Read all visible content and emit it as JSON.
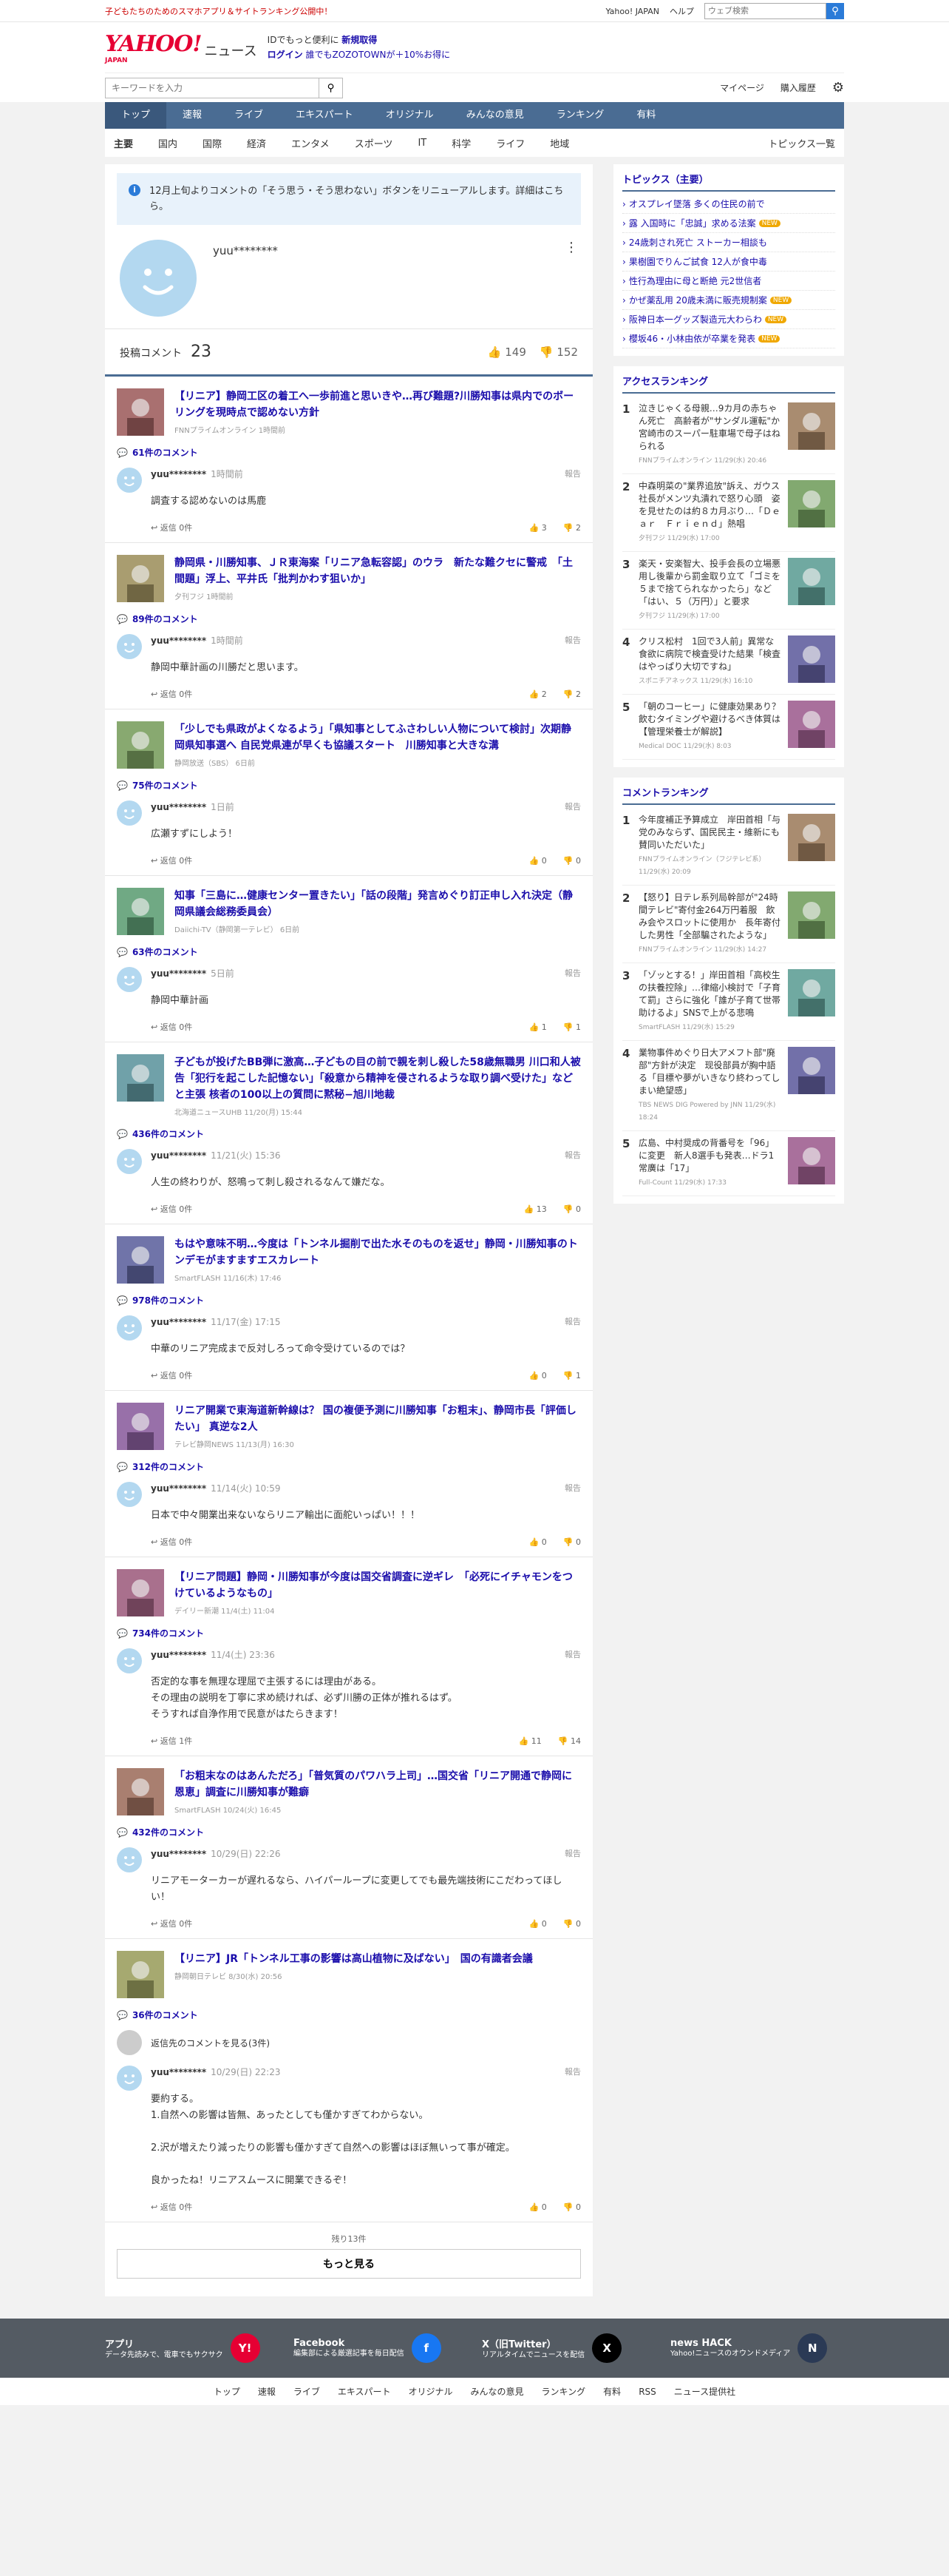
{
  "topbar": {
    "promo": "子どもたちのためのスマホアプリ＆サイトランキング公開中！",
    "link1": "Yahoo! JAPAN",
    "link2": "ヘルプ",
    "search_placeholder": "ウェブ検索"
  },
  "header": {
    "logo": "YAHOO!",
    "logo_sub": "JAPAN",
    "section": "ニュース",
    "line1a": "IDでもっと便利に",
    "line1b": "新規取得",
    "line2a": "ログイン",
    "line2b": "誰でもZOZOTOWNが＋10%お得に"
  },
  "searchrow": {
    "placeholder": "キーワードを入力",
    "mypage": "マイページ",
    "history": "購入履歴"
  },
  "gnav": [
    "トップ",
    "速報",
    "ライブ",
    "エキスパート",
    "オリジナル",
    "みんなの意見",
    "ランキング",
    "有料"
  ],
  "snav": [
    "主要",
    "国内",
    "国際",
    "経済",
    "エンタメ",
    "スポーツ",
    "IT",
    "科学",
    "ライフ",
    "地域"
  ],
  "snav_right": "トピックス一覧",
  "notice": "12月上旬よりコメントの「そう思う・そう思わない」ボタンをリニューアルします。詳細はこちら。",
  "profile": {
    "name": "yuu********",
    "count_label": "投稿コメント",
    "count": "23",
    "likes": "149",
    "dislikes": "152"
  },
  "reply_label": "返信",
  "report_label": "報告",
  "cards": [
    {
      "title": "【リニア】静岡工区の着工へ一歩前進と思いきや…再び難題?川勝知事は県内でのボーリングを現時点で認めない方針",
      "src": "FNNプライムオンライン 1時間前",
      "ccount": "61件のコメント",
      "user": "yuu********",
      "time": "1時間前",
      "text": "調査する認めないのは馬鹿",
      "replies": "0件",
      "up": "3",
      "down": "2"
    },
    {
      "title": "静岡県・川勝知事、ＪＲ東海案「リニア急転容認」のウラ　新たな難クセに警戒　「土間題」浮上、平井氏「批判かわす狙いか」",
      "src": "夕刊フジ 1時間前",
      "ccount": "89件のコメント",
      "user": "yuu********",
      "time": "1時間前",
      "text": "静岡中華計画の川勝だと思います。",
      "replies": "0件",
      "up": "2",
      "down": "2"
    },
    {
      "title": "「少しでも県政がよくなるよう」「県知事としてふさわしい人物について検討」次期静岡県知事選へ 自民党県連が早くも協議スタート　川勝知事と大きな溝",
      "src": "静岡放送（SBS） 6日前",
      "ccount": "75件のコメント",
      "user": "yuu********",
      "time": "1日前",
      "text": "広瀬すずにしよう！",
      "replies": "0件",
      "up": "0",
      "down": "0"
    },
    {
      "title": "知事「三島に…健康センター置きたい」「話の段階」発言めぐり訂正申し入れ決定（静岡県議会総務委員会）",
      "src": "Daiichi-TV（静岡第一テレビ） 6日前",
      "ccount": "63件のコメント",
      "user": "yuu********",
      "time": "5日前",
      "text": "静岡中華計画",
      "replies": "0件",
      "up": "1",
      "down": "1"
    },
    {
      "title": "子どもが投げたBB弾に激高…子どもの目の前で親を刺し殺した58歳無職男 川口和人被告「犯行を起こした記憶ない」「殺意から精神を侵されるような取り調べ受けた」などと主張 核者の100以上の質問に黙秘−旭川地裁",
      "src": "北海道ニュースUHB 11/20(月) 15:44",
      "ccount": "436件のコメント",
      "user": "yuu********",
      "time": "11/21(火) 15:36",
      "text": "人生の終わりが、怒鳴って刺し殺されるなんて嫌だな。",
      "replies": "0件",
      "up": "13",
      "down": "0"
    },
    {
      "title": "もはや意味不明…今度は「トンネル掘削で出た水そのものを返せ」静岡・川勝知事のトンデモがますますエスカレート",
      "src": "SmartFLASH 11/16(木) 17:46",
      "ccount": "978件のコメント",
      "user": "yuu********",
      "time": "11/17(金) 17:15",
      "text": "中華のリニア完成まで反対しろって命令受けているのでは？",
      "replies": "0件",
      "up": "0",
      "down": "1"
    },
    {
      "title": "リニア開業で東海道新幹線は？ 国の複便予測に川勝知事「お粗末」、静岡市長「評価したい」 真逆な2人",
      "src": "テレビ静岡NEWS 11/13(月) 16:30",
      "ccount": "312件のコメント",
      "user": "yuu********",
      "time": "11/14(火) 10:59",
      "text": "日本で中々開業出来ないならリニア輸出に面舵いっぱい！！！",
      "replies": "0件",
      "up": "0",
      "down": "0"
    },
    {
      "title": "【リニア問題】静岡・川勝知事が今度は国交省調査に逆ギレ　「必死にイチャモンをつけているようなもの」",
      "src": "デイリー新潮 11/4(土) 11:04",
      "ccount": "734件のコメント",
      "user": "yuu********",
      "time": "11/4(土) 23:36",
      "text": "否定的な事を無理な理屈で主張するには理由がある。\nその理由の説明を丁寧に求め続ければ、必ず川勝の正体が推れるはず。\nそうすれば自浄作用で民意がはたらきます！",
      "replies": "1件",
      "up": "11",
      "down": "14"
    },
    {
      "title": "「お粗末なのはあんただろ」「普気質のパワハラ上司」…国交省「リニア開通で静岡に恩恵」調査に川勝知事が難癖",
      "src": "SmartFLASH 10/24(火) 16:45",
      "ccount": "432件のコメント",
      "user": "yuu********",
      "time": "10/29(日) 22:26",
      "text": "リニアモーターカーが遅れるなら、ハイパーループに変更してでも最先端技術にこだわってほしい！",
      "replies": "0件",
      "up": "0",
      "down": "0"
    },
    {
      "title": "【リニア】JR「トンネル工事の影響は高山植物に及ばない」　国の有識者会議",
      "src": "静岡朝日テレビ 8/30(水) 20:56",
      "ccount": "36件のコメント",
      "prev": "返信先のコメントを見る(3件)",
      "user": "yuu********",
      "time": "10/29(日) 22:23",
      "text": "要約する。\n1.自然への影響は皆無、あったとしても僅かすぎてわからない。\n\n2.沢が増えたり減ったりの影響も僅かすぎて自然への影響はほぼ無いって事が確定。\n\n良かったね！リニアスムースに開業できるぞ！",
      "replies": "0件",
      "up": "0",
      "down": "0"
    }
  ],
  "more": {
    "remain": "残り13件",
    "label": "もっと見る"
  },
  "side": {
    "topics_title": "トピックス（主要）",
    "topics": [
      {
        "t": "オスプレイ墜落 多くの住民の前で",
        "new": ""
      },
      {
        "t": "露 入国時に「忠誠」求める法案",
        "new": "NEW"
      },
      {
        "t": "24歳刺され死亡 ストーカー相談も",
        "new": ""
      },
      {
        "t": "果樹園でりんご試食 12人が食中毒",
        "new": ""
      },
      {
        "t": "性行為理由に母と断絶 元2世信者",
        "new": ""
      },
      {
        "t": "かぜ薬乱用 20歳未満に販売規制案",
        "new": "NEW"
      },
      {
        "t": "阪神日本一グッズ製造元大わらわ",
        "new": "NEW"
      },
      {
        "t": "櫻坂46・小林由依が卒業を発表",
        "new": "NEW"
      }
    ],
    "access_title": "アクセスランキング",
    "access": [
      {
        "n": "1",
        "t": "泣きじゃくる母親…9カ月の赤ちゃん死亡　高齢者が\"サンダル運転\"か　宮崎市のスーパー駐車場で母子はねられる",
        "s": "FNNプライムオンライン 11/29(水) 20:46"
      },
      {
        "n": "2",
        "t": "中森明菜の\"業界追放\"訴え、ガウス社長がメンツ丸潰れで怒り心頭　姿を見せたのは約８カ月ぶり…「Ｄｅａｒ　Ｆｒｉｅｎｄ」熱唱",
        "s": "夕刊フジ 11/29(水) 17:00"
      },
      {
        "n": "3",
        "t": "楽天・安楽智大、投手会長の立場悪用し後輩から罰金取り立て「ゴミを５まで捨てられなかったら」など「はい、５（万円）」と要求",
        "s": "夕刊フジ 11/29(水) 17:00"
      },
      {
        "n": "4",
        "t": "クリス松村　1回で3人前」異常な食欲に病院で検査受けた結果「検査はやっぱり大切ですね」",
        "s": "スポニチアネックス 11/29(水) 16:10"
      },
      {
        "n": "5",
        "t": "「朝のコーヒー」に健康効果あり？ 飲むタイミングや避けるべき体質は【管理栄養士が解説】",
        "s": "Medical DOC 11/29(水) 8:03"
      }
    ],
    "comment_title": "コメントランキング",
    "comments": [
      {
        "n": "1",
        "t": "今年度補正予算成立　岸田首相「与党のみならず、国民民主・維新にも賛同いただいた」",
        "s": "FNNプライムオンライン（フジテレビ系） 11/29(水) 20:09"
      },
      {
        "n": "2",
        "t": "【怒り】日テレ系列局幹部が\"24時間テレビ\"寄付金264万円着服　飲み会やスロットに使用か　長年寄付した男性「全部騙されたような」",
        "s": "FNNプライムオンライン 11/29(水) 14:27"
      },
      {
        "n": "3",
        "t": "「ゾッとする！」岸田首相「高校生の扶養控除」…律縮小検討で「子育て罰」さらに強化「誰が子育て世帯助けるよ」SNSで上がる悲鳴",
        "s": "SmartFLASH 11/29(水) 15:29"
      },
      {
        "n": "4",
        "t": "業物事件めぐり日大アメフト部\"廃部\"方針が決定　现役部員が胸中語る「目標や夢がいきなり終わってしまい絶望感」",
        "s": "TBS NEWS DIG Powered by JNN 11/29(水) 18:24"
      },
      {
        "n": "5",
        "t": "広島、中村奨成の背番号を「96」に変更　新人8選手も発表…ドラ1常廣は「17」",
        "s": "Full-Count 11/29(水) 17:33"
      }
    ]
  },
  "footer": {
    "cols": [
      {
        "title": "アプリ",
        "desc": "データ先読みで、電車でもサクサク"
      },
      {
        "title": "Facebook",
        "desc": "編集部による厳選記事を毎日配信"
      },
      {
        "title": "X（旧Twitter）",
        "desc": "リアルタイムでニュースを配信"
      },
      {
        "title": "news HACK",
        "desc": "Yahoo!ニュースのオウンドメディア"
      }
    ],
    "nav": [
      "トップ",
      "速報",
      "ライブ",
      "エキスパート",
      "オリジナル",
      "みんなの意見",
      "ランキング",
      "有料",
      "RSS",
      "ニュース提供社"
    ]
  }
}
